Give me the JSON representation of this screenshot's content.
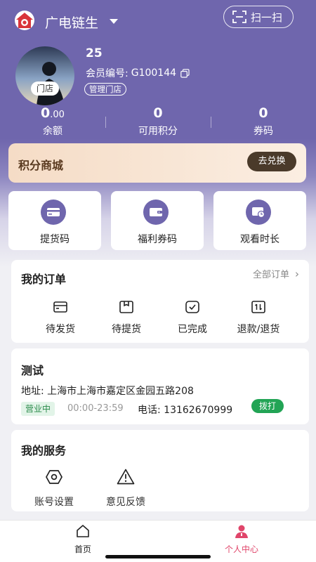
{
  "header": {
    "app_title": "广电链生",
    "scan_label": "扫一扫"
  },
  "profile": {
    "store_tag": "门店",
    "user_name": "25",
    "member_label": "会员编号:",
    "member_id": "G100144",
    "manage_store": "管理门店"
  },
  "stats": [
    {
      "value_main": "0",
      "value_decimal": ".00",
      "label": "余额"
    },
    {
      "value_main": "0",
      "value_decimal": "",
      "label": "可用积分"
    },
    {
      "value_main": "0",
      "value_decimal": "",
      "label": "券码"
    }
  ],
  "points_mall": {
    "title": "积分商城",
    "redeem_label": "去兑换"
  },
  "quick_actions": [
    {
      "label": "提货码",
      "icon": "card-icon"
    },
    {
      "label": "福利券码",
      "icon": "wallet-icon"
    },
    {
      "label": "观看时长",
      "icon": "video-clock-icon"
    }
  ],
  "orders": {
    "title": "我的订单",
    "all_label": "全部订单",
    "items": [
      {
        "label": "待发货",
        "icon": "pending-ship-icon"
      },
      {
        "label": "待提货",
        "icon": "pending-pickup-icon"
      },
      {
        "label": "已完成",
        "icon": "completed-icon"
      },
      {
        "label": "退款/退货",
        "icon": "refund-icon"
      }
    ]
  },
  "store": {
    "name": "测试",
    "address": "地址: 上海市上海市嘉定区金园五路208",
    "status": "营业中",
    "hours": "00:00-23:59",
    "phone": "电话: 13162670999",
    "call_label": "拨打"
  },
  "services": {
    "title": "我的服务",
    "items": [
      {
        "label": "账号设置",
        "icon": "settings-icon"
      },
      {
        "label": "意见反馈",
        "icon": "warning-icon"
      }
    ]
  },
  "tabbar": {
    "home": "首页",
    "profile": "个人中心",
    "active_color": "#e0456a",
    "inactive_color": "#222222"
  },
  "colors": {
    "brand": "#6f66ad",
    "call_green": "#22a455",
    "redeem_dark": "#4a3a2a"
  }
}
